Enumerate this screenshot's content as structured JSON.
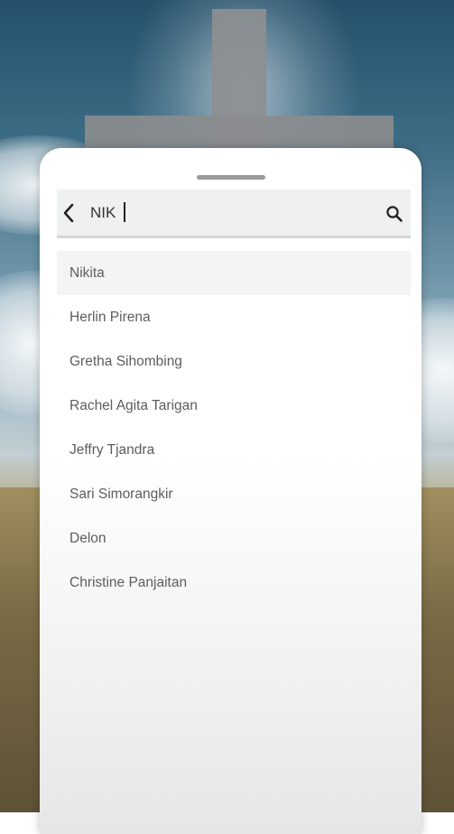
{
  "search": {
    "value": "NIK",
    "back_icon": "chevron-left-icon",
    "search_icon": "search-icon"
  },
  "results": [
    "Nikita",
    "Herlin Pirena",
    "Gretha Sihombing",
    "Rachel Agita Tarigan",
    "Jeffry Tjandra",
    "Sari Simorangkir",
    "Delon",
    "Christine Panjaitan"
  ],
  "colors": {
    "card_bg": "#ffffff",
    "search_bg": "#eef1f0",
    "text": "#5d5d5d",
    "highlight_row": "#f4f4f4"
  }
}
